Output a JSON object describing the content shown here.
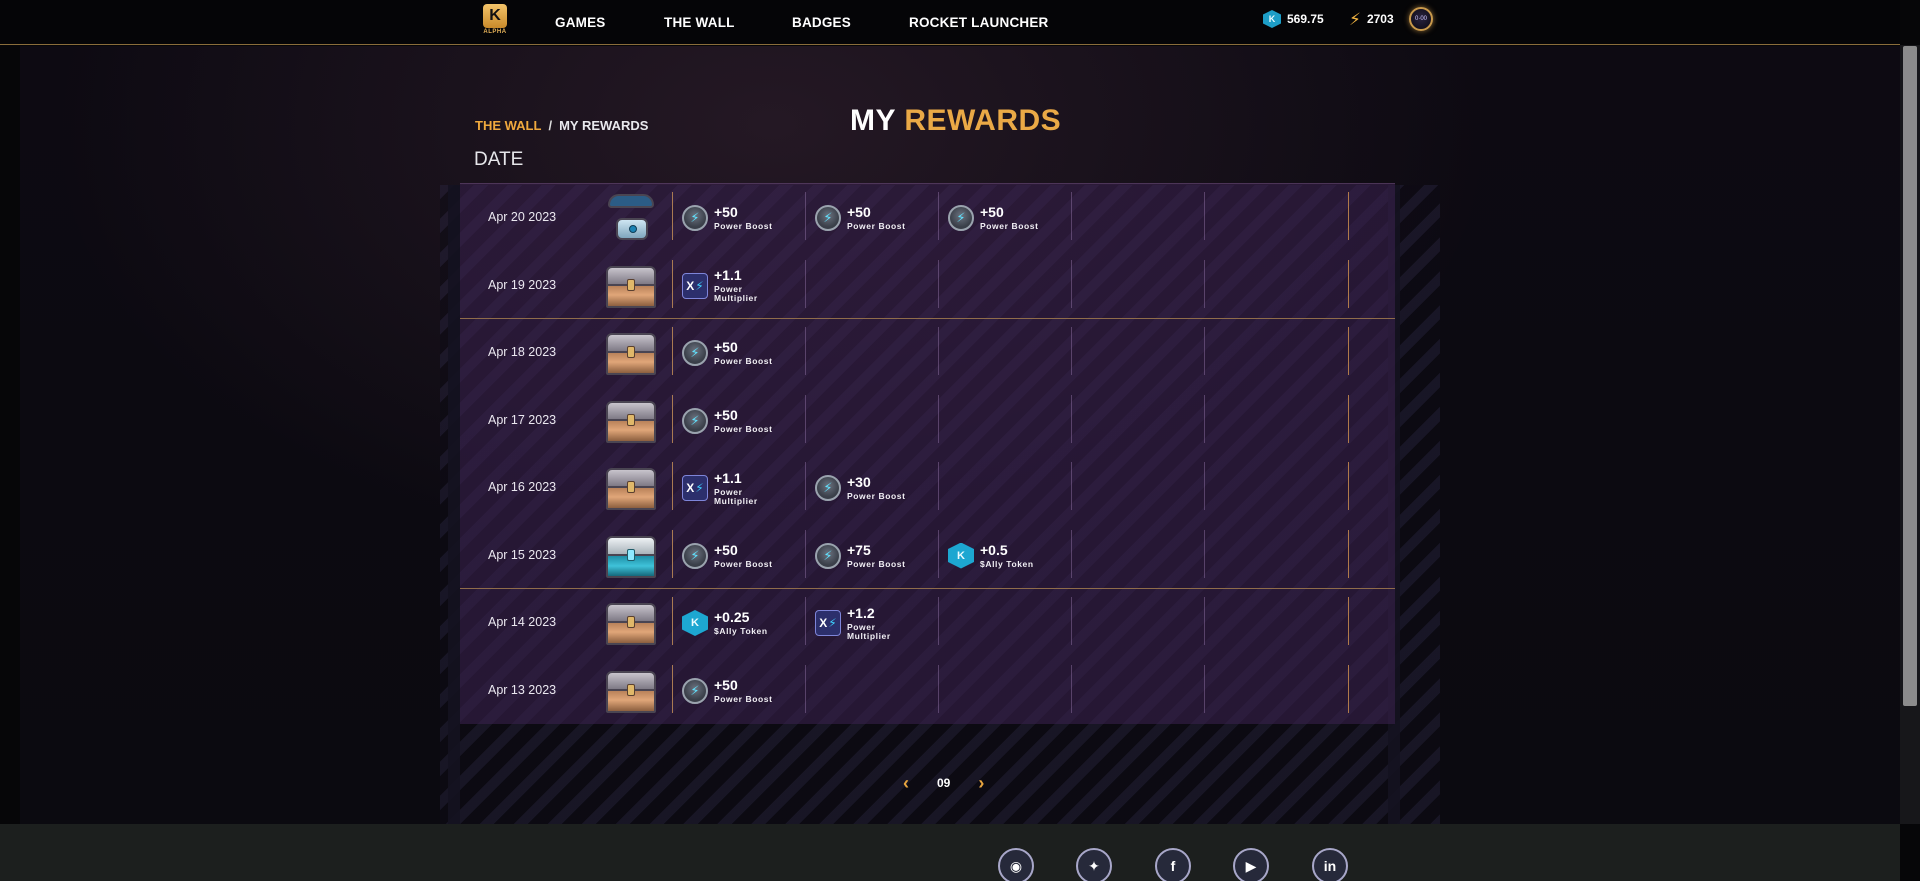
{
  "nav": {
    "logo_text": "K",
    "logo_tag": "ALPHA",
    "items": [
      "GAMES",
      "THE WALL",
      "BADGES",
      "ROCKET LAUNCHER"
    ],
    "ally_balance": "569.75",
    "power_balance": "2703",
    "avatar_text": "0·00",
    "icons": {
      "ally": "ally-token-icon",
      "power": "bolt-icon"
    }
  },
  "breadcrumb": {
    "link": "THE WALL",
    "separator": "/",
    "current": "MY REWARDS"
  },
  "title": {
    "prefix": "MY",
    "accent": "REWARDS"
  },
  "date_header": "DATE",
  "rows": [
    {
      "date": "Apr 20 2023",
      "chest": "para",
      "rewards": [
        {
          "type": "boost",
          "amount": "+50",
          "label": "Power Boost"
        },
        {
          "type": "boost",
          "amount": "+50",
          "label": "Power Boost"
        },
        {
          "type": "boost",
          "amount": "+50",
          "label": "Power Boost"
        }
      ]
    },
    {
      "date": "Apr 19 2023",
      "chest": "common",
      "rewards": [
        {
          "type": "mult",
          "amount": "+1.1",
          "label": "Power Multiplier"
        }
      ]
    },
    {
      "date": "Apr 18 2023",
      "chest": "common",
      "rewards": [
        {
          "type": "boost",
          "amount": "+50",
          "label": "Power Boost"
        }
      ]
    },
    {
      "date": "Apr 17 2023",
      "chest": "common",
      "rewards": [
        {
          "type": "boost",
          "amount": "+50",
          "label": "Power Boost"
        }
      ]
    },
    {
      "date": "Apr 16 2023",
      "chest": "common",
      "rewards": [
        {
          "type": "mult",
          "amount": "+1.1",
          "label": "Power Multiplier"
        },
        {
          "type": "boost",
          "amount": "+30",
          "label": "Power Boost"
        }
      ]
    },
    {
      "date": "Apr 15 2023",
      "chest": "rare",
      "rewards": [
        {
          "type": "boost",
          "amount": "+50",
          "label": "Power Boost"
        },
        {
          "type": "boost",
          "amount": "+75",
          "label": "Power Boost"
        },
        {
          "type": "token",
          "amount": "+0.5",
          "label": "$Ally Token"
        }
      ]
    },
    {
      "date": "Apr 14 2023",
      "chest": "common",
      "rewards": [
        {
          "type": "token",
          "amount": "+0.25",
          "label": "$Ally Token"
        },
        {
          "type": "mult",
          "amount": "+1.2",
          "label": "Power Multiplier"
        }
      ]
    },
    {
      "date": "Apr 13 2023",
      "chest": "common",
      "rewards": [
        {
          "type": "boost",
          "amount": "+50",
          "label": "Power Boost"
        }
      ]
    }
  ],
  "pagination": {
    "prev": "‹",
    "page": "09",
    "next": "›"
  },
  "social": [
    {
      "name": "discord-icon",
      "glyph": "◉"
    },
    {
      "name": "twitter-icon",
      "glyph": "✦"
    },
    {
      "name": "facebook-icon",
      "glyph": "f"
    },
    {
      "name": "youtube-icon",
      "glyph": "▶"
    },
    {
      "name": "linkedin-icon",
      "glyph": "in"
    }
  ],
  "colors": {
    "accent": "#eaa946",
    "panel": "#3c2250",
    "token": "#1da7d1"
  }
}
